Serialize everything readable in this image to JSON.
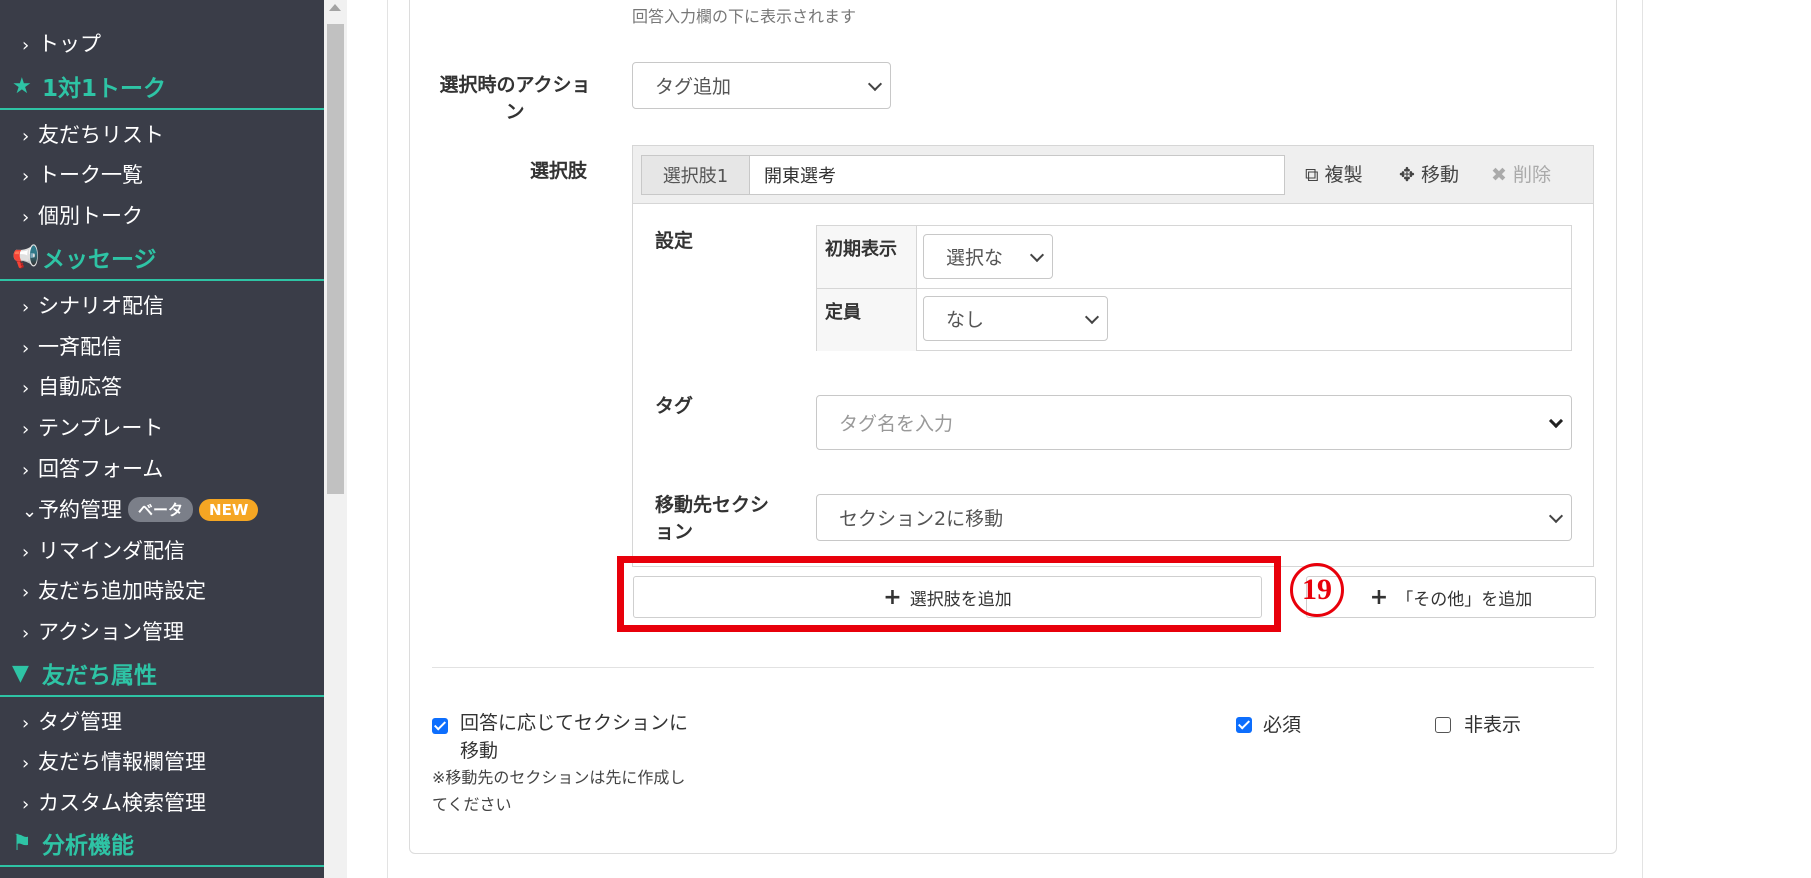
{
  "sidebar": {
    "items": [
      {
        "label": "トップ"
      },
      {
        "section": "1対1トーク",
        "icon": "star-icon"
      },
      {
        "label": "友だちリスト"
      },
      {
        "label": "トーク一覧"
      },
      {
        "label": "個別トーク"
      },
      {
        "section": "メッセージ",
        "icon": "megaphone-icon"
      },
      {
        "label": "シナリオ配信"
      },
      {
        "label": "一斉配信"
      },
      {
        "label": "自動応答"
      },
      {
        "label": "テンプレート"
      },
      {
        "label": "回答フォーム"
      },
      {
        "label": "予約管理",
        "badges": [
          "ベータ",
          "NEW"
        ]
      },
      {
        "label": "リマインダ配信"
      },
      {
        "label": "友だち追加時設定"
      },
      {
        "label": "アクション管理"
      },
      {
        "section": "友だち属性",
        "icon": "filter-icon"
      },
      {
        "label": "タグ管理"
      },
      {
        "label": "友だち情報欄管理"
      },
      {
        "label": "カスタム検索管理"
      },
      {
        "section": "分析機能",
        "icon": "flag-icon"
      }
    ]
  },
  "form": {
    "hint_text": "回答入力欄の下に表示されます",
    "action_label": "選択時のアクション",
    "action_select": "タグ追加",
    "choices_label": "選択肢",
    "choice": {
      "tag": "選択肢1",
      "value": "開東選考",
      "copy_label": "複製",
      "move_label": "移動",
      "delete_label": "削除"
    },
    "settings_label": "設定",
    "initial_display_label": "初期表示",
    "initial_display_value": "選択な",
    "capacity_label": "定員",
    "capacity_value": "なし",
    "tag_label": "タグ",
    "tag_placeholder": "タグ名を入力",
    "dest_label": "移動先セクション",
    "dest_value": "セクション2に移動",
    "add_choice_label": "選択肢を追加",
    "add_other_label": "「その他」を追加",
    "annotation_number": "⑲",
    "move_by_answer_label": "回答に応じてセクションに移動",
    "move_by_answer_checked": true,
    "move_note": "※移動先のセクションは先に作成してください",
    "required_label": "必須",
    "required_checked": true,
    "hidden_label": "非表示",
    "hidden_checked": false
  },
  "colors": {
    "sidebar_bg": "#3a3d48",
    "accent": "#2ec4a5",
    "highlight": "#e8000b",
    "checkbox": "#0d6efd",
    "badge_beta": "#7b7f89",
    "badge_new": "#f5a623"
  }
}
